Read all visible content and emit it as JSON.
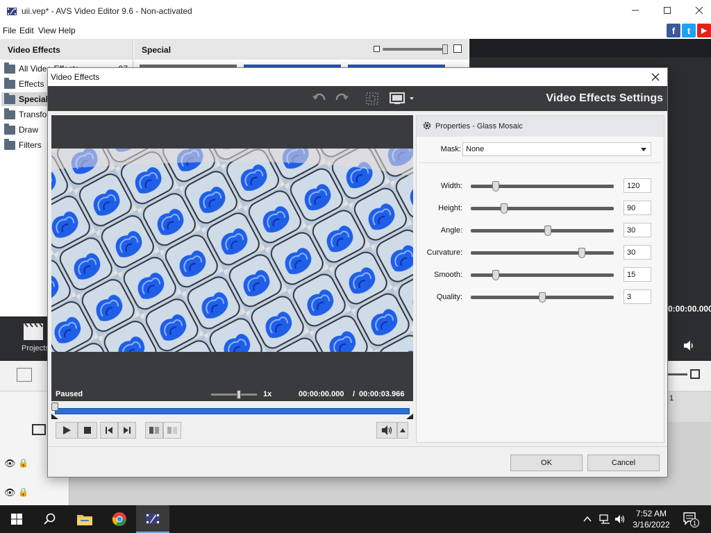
{
  "window": {
    "title": "uii.vep* - AVS Video Editor 9.6 - Non-activated"
  },
  "menu": [
    "File",
    "Edit",
    "View",
    "Help"
  ],
  "social": [
    {
      "name": "facebook",
      "glyph": "f",
      "color": "#3b5998"
    },
    {
      "name": "twitter",
      "glyph": "t",
      "color": "#1da1f2"
    },
    {
      "name": "youtube",
      "glyph": "▶",
      "color": "#e62117"
    }
  ],
  "left_panel": {
    "header": "Video Effects",
    "items": [
      {
        "label": "All Video Effects",
        "count": "97"
      },
      {
        "label": "Effects"
      },
      {
        "label": "Special"
      },
      {
        "label": "Transform"
      },
      {
        "label": "Draw"
      },
      {
        "label": "Filters"
      }
    ]
  },
  "center_panel": {
    "header": "Special"
  },
  "background": {
    "projects_label": "Projects",
    "time_partial": "0:00:00.000",
    "ruler_mark": "1"
  },
  "dialog": {
    "title": "Video Effects",
    "heading": "Video Effects Settings",
    "properties_title": "Properties - Glass Mosaic",
    "mask_label": "Mask:",
    "mask_value": "None",
    "params": [
      {
        "label": "Width:",
        "value": "120",
        "position": 0.16
      },
      {
        "label": "Height:",
        "value": "90",
        "position": 0.22
      },
      {
        "label": "Angle:",
        "value": "30",
        "position": 0.54
      },
      {
        "label": "Curvature:",
        "value": "30",
        "position": 0.79
      },
      {
        "label": "Smooth:",
        "value": "15",
        "position": 0.16
      },
      {
        "label": "Quality:",
        "value": "3",
        "position": 0.5
      }
    ],
    "status": "Paused",
    "speed": "1x",
    "speed_position": 0.62,
    "time_current": "00:00:00.000",
    "time_separator": "/",
    "time_total": "00:00:03.966",
    "ok_label": "OK",
    "cancel_label": "Cancel"
  },
  "taskbar": {
    "time": "7:52 AM",
    "date": "3/16/2022",
    "notifications": "1"
  },
  "colors": {
    "accent_blue": "#2e6fd6",
    "dark_panel": "#3a3b3e",
    "taskbar": "#1a1a1a"
  }
}
